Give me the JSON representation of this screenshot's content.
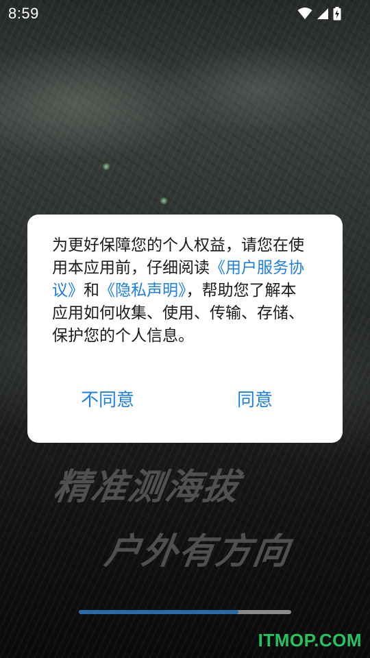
{
  "status_bar": {
    "time": "8:59"
  },
  "dialog": {
    "text_before_user_agreement": "为更好保障您的个人权益，请您在使用本应用前，仔细阅读",
    "user_agreement_link": "《用户服务协议》",
    "text_and": "和",
    "privacy_link": "《隐私声明》",
    "text_after_privacy": "，帮助您了解本应用如何收集、使用、传输、存储、保护您的个人信息。",
    "disagree_label": "不同意",
    "agree_label": "同意"
  },
  "slogan": {
    "line1": "精准测海拔",
    "line2": "户外有方向"
  },
  "loading_progress": 0.75,
  "watermark": "ITMOP.COM",
  "colors": {
    "accent": "#1d7fe0",
    "watermark": "#22c55e",
    "progress_fill": "#2a6aa8"
  }
}
